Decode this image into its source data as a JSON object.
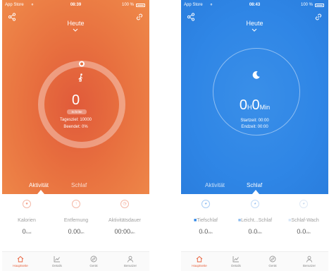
{
  "left": {
    "status": {
      "carrier": "App Store",
      "time": "08:39",
      "battery": "100 %"
    },
    "title": "Heute",
    "steps": "0",
    "badge": "Schritte",
    "goal": "Tagesziel: 10000",
    "done": "Beendet: 0%",
    "tabs": [
      {
        "label": "Aktivität"
      },
      {
        "label": "Schlaf"
      }
    ],
    "stats": [
      {
        "label": "Kalorien",
        "value": "0",
        "unit": "Kcal"
      },
      {
        "label": "Entfernung",
        "value": "0.00",
        "unit": "km"
      },
      {
        "label": "Aktivitätsdauer",
        "value": "00:00",
        "unit": "Min"
      }
    ],
    "accent": "#e8613c"
  },
  "right": {
    "status": {
      "carrier": "App Store",
      "time": "08:43",
      "battery": "100 %"
    },
    "title": "Heute",
    "sleep_h": "0",
    "sleep_h_unit": "H",
    "sleep_m": "0",
    "sleep_m_unit": "Min",
    "start": "Startzeit: 00:00",
    "end": "Endzeit: 00:00",
    "tabs": [
      {
        "label": "Aktivität"
      },
      {
        "label": "Schlaf"
      }
    ],
    "stats": [
      {
        "label": "Tiefschlaf",
        "value": "0",
        "unit_h": "H",
        "value_m": "0",
        "unit_m": "Min"
      },
      {
        "label": "Leicht...Schlaf",
        "value": "0",
        "unit_h": "H",
        "value_m": "0",
        "unit_m": "Min"
      },
      {
        "label": "Schlaf-Wach",
        "value": "0",
        "unit_h": "H",
        "value_m": "0",
        "unit_m": "Min"
      }
    ],
    "accent": "#2f86e6"
  },
  "nav": [
    {
      "label": "Hauptseite"
    },
    {
      "label": "Details"
    },
    {
      "label": "Gerät"
    },
    {
      "label": "Benutzer"
    }
  ]
}
